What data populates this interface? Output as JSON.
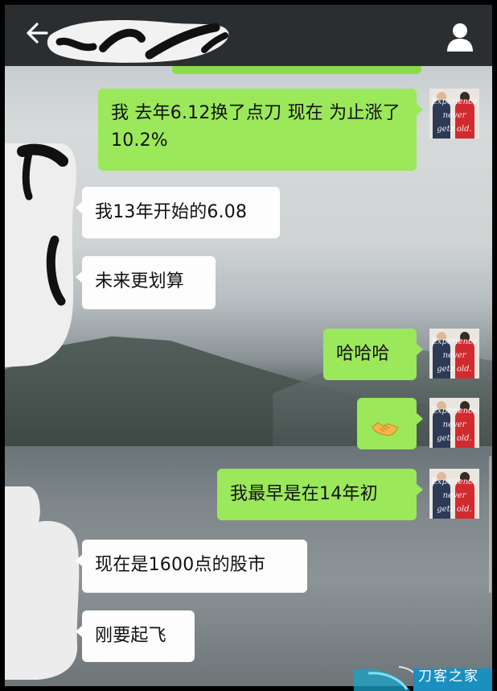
{
  "header": {
    "back_icon": "arrow-left-icon",
    "profile_icon": "person-icon"
  },
  "messages": [
    {
      "side": "out",
      "text": "我 去年6.12换了点刀 现在 为止涨了10.2%"
    },
    {
      "side": "in",
      "text": "我13年开始的6.08"
    },
    {
      "side": "in",
      "text": "未来更划算"
    },
    {
      "side": "out",
      "text": "哈哈哈"
    },
    {
      "side": "out",
      "emoji": "handshake-emoji"
    },
    {
      "side": "out",
      "text": "我最早是在14年初"
    },
    {
      "side": "in",
      "text": "现在是1600点的股市"
    },
    {
      "side": "in",
      "text": "刚要起飞"
    }
  ],
  "avatar": {
    "caption_line1": "Experience",
    "caption_line2": "never",
    "caption_line3": "gets old."
  },
  "watermark": {
    "text": "刀客之家"
  },
  "colors": {
    "outgoing_bubble": "#9be85b",
    "incoming_bubble": "#fdfdfd",
    "header": "#2b2e31"
  }
}
